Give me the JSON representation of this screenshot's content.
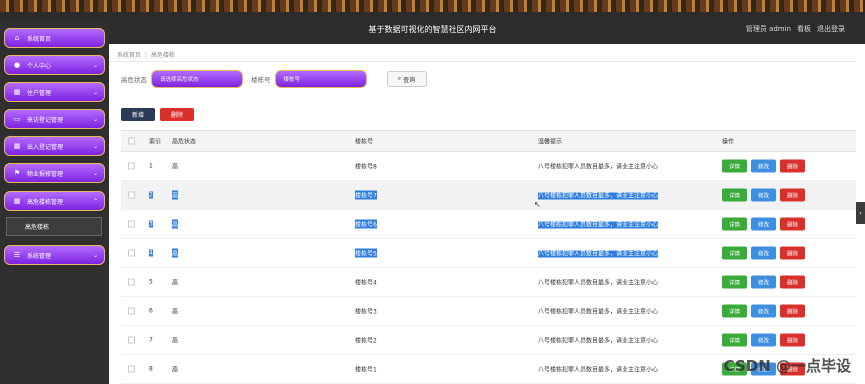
{
  "header": {
    "title": "基于数据可视化的智慧社区内网平台",
    "user_text": "管理员 admin",
    "dashboard_label": "看板",
    "logout_label": "退出登录"
  },
  "sidebar": {
    "items": [
      {
        "label": "系统首页",
        "icon": "home-icon"
      },
      {
        "label": "个人中心",
        "icon": "user-icon"
      },
      {
        "label": "住户管理",
        "icon": "grid-icon"
      },
      {
        "label": "来访登记管理",
        "icon": "monitor-icon"
      },
      {
        "label": "出入登记管理",
        "icon": "grid-icon"
      },
      {
        "label": "物业报修管理",
        "icon": "flag-icon"
      },
      {
        "label": "高危楼栋管理",
        "icon": "grid-icon"
      },
      {
        "label": "系统管理",
        "icon": "sliders-icon"
      }
    ],
    "submenu_label": "高危楼栋"
  },
  "breadcrumb": {
    "home": "系统首页",
    "current": "高危楼栋"
  },
  "filters": {
    "status_label": "高危状态",
    "status_placeholder": "请选择高危状态",
    "building_label": "楼栋号",
    "building_placeholder": "楼栋号",
    "search_label": "查询"
  },
  "toolbar": {
    "new_label": "新增",
    "delete_label": "删除"
  },
  "table": {
    "headers": {
      "index": "索引",
      "status": "高危状态",
      "building": "楼栋号",
      "tip": "温馨提示",
      "ops": "操作"
    },
    "op_labels": {
      "detail": "详情",
      "edit": "修改",
      "delete": "删除"
    },
    "rows": [
      {
        "index": "1",
        "status": "高",
        "building": "楼栋号8",
        "tip": "八号楼栋犯罪人员数目最多，请业主注意小心"
      },
      {
        "index": "2",
        "status": "高",
        "building": "楼栋号7",
        "tip": "八号楼栋犯罪人员数目最多，请业主注意小心"
      },
      {
        "index": "3",
        "status": "高",
        "building": "楼栋号6",
        "tip": "八号楼栋犯罪人员数目最多，请业主注意小心"
      },
      {
        "index": "4",
        "status": "高",
        "building": "楼栋号5",
        "tip": "八号楼栋犯罪人员数目最多，请业主注意小心"
      },
      {
        "index": "5",
        "status": "高",
        "building": "楼栋号4",
        "tip": "八号楼栋犯罪人员数目最多，请业主注意小心"
      },
      {
        "index": "6",
        "status": "高",
        "building": "楼栋号3",
        "tip": "八号楼栋犯罪人员数目最多，请业主注意小心"
      },
      {
        "index": "7",
        "status": "高",
        "building": "楼栋号2",
        "tip": "八号楼栋犯罪人员数目最多，请业主注意小心"
      },
      {
        "index": "8",
        "status": "高",
        "building": "楼栋号1",
        "tip": "八号楼栋犯罪人员数目最多，请业主注意小心"
      }
    ]
  },
  "watermark": "CSDN @一点毕设",
  "colors": {
    "menu_purple": "#8b2ff0",
    "menu_border": "#e8b95c",
    "selection_blue": "#2e7de0"
  }
}
